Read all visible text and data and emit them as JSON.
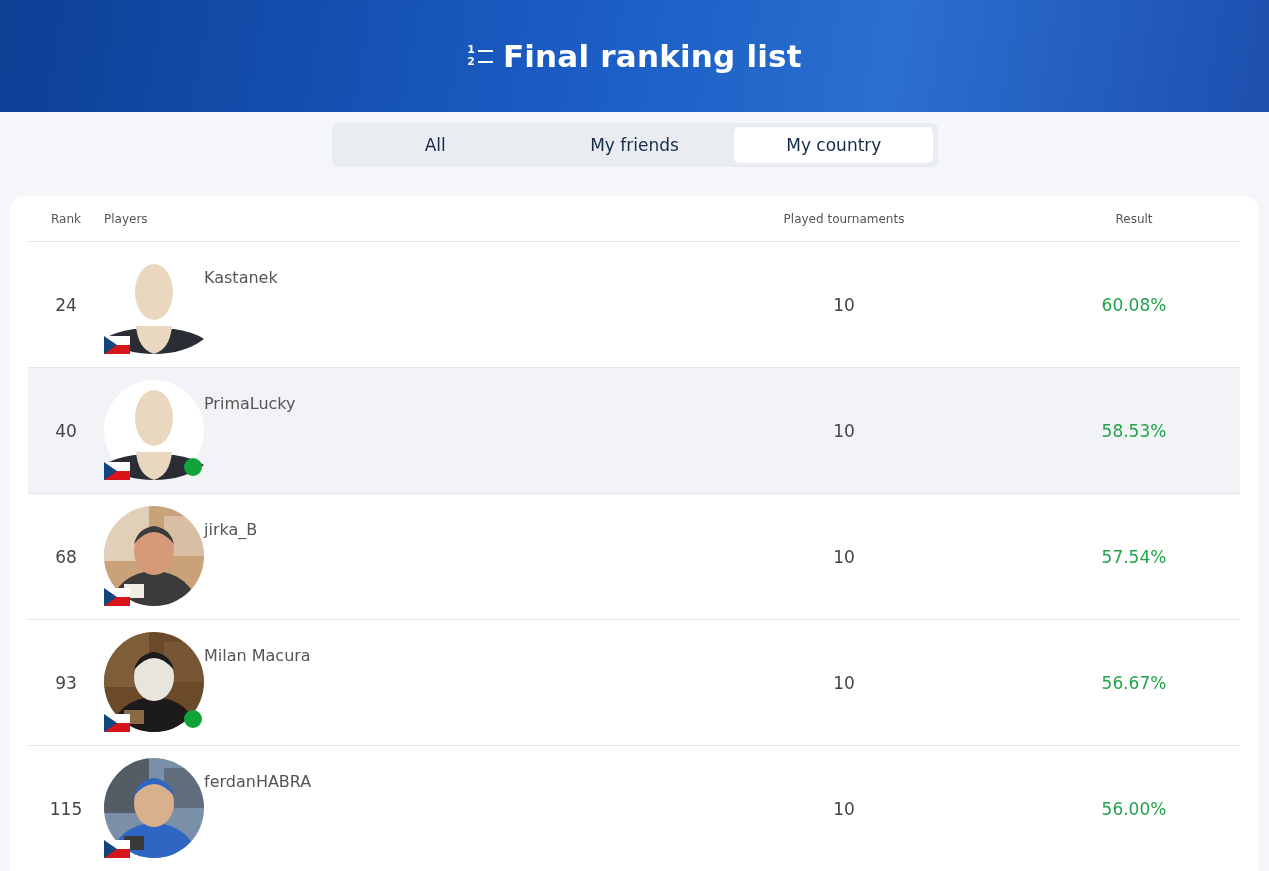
{
  "header": {
    "icon_digits": [
      "1",
      "2"
    ],
    "title": "Final ranking list"
  },
  "tabs": [
    {
      "label": "All",
      "selected": false
    },
    {
      "label": "My friends",
      "selected": false
    },
    {
      "label": "My country",
      "selected": true
    }
  ],
  "table": {
    "columns": [
      "Rank",
      "Players",
      "Played tournaments",
      "Result"
    ],
    "rows": [
      {
        "rank": "24",
        "name": "Kastanek",
        "avatar": {
          "kind": "default"
        },
        "online": false,
        "selected": false,
        "played": "10",
        "result": "60.08%"
      },
      {
        "rank": "40",
        "name": "PrimaLucky",
        "avatar": {
          "kind": "default"
        },
        "online": true,
        "selected": true,
        "played": "10",
        "result": "58.53%"
      },
      {
        "rank": "68",
        "name": "jirka_B",
        "online": false,
        "selected": false,
        "played": "10",
        "result": "57.54%"
      },
      {
        "rank": "93",
        "name": "Milan Macura",
        "online": true,
        "selected": false,
        "played": "10",
        "result": "56.67%"
      },
      {
        "rank": "115",
        "name": "ferdanHABRA",
        "online": false,
        "selected": false,
        "played": "10",
        "result": "56.00%"
      }
    ]
  }
}
